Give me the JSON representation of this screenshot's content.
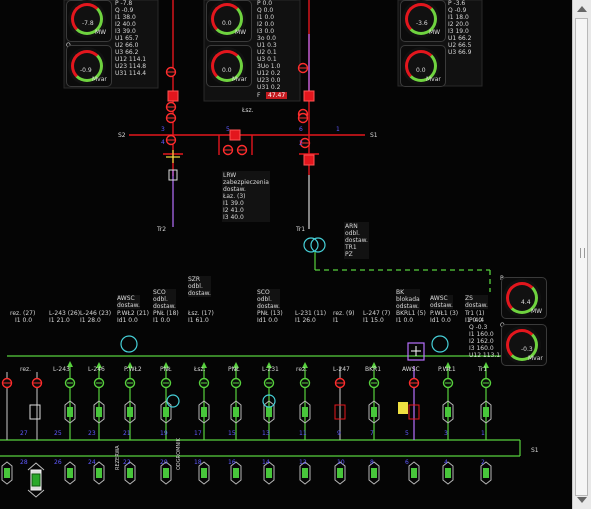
{
  "colors": {
    "bus": "#7ddc4d",
    "red": "#e3161d",
    "green": "#50d13c",
    "purple": "#b770ff",
    "cyan": "#46d0d8",
    "yellow": "#efe041",
    "bg": "#050505",
    "panel": "#111111",
    "text": "#d8d8d8"
  },
  "top_left_meters": [
    {
      "name": "P",
      "value": "-7.8",
      "unit": "MW"
    },
    {
      "name": "Q",
      "value": "-0.9",
      "unit": "Mvar"
    }
  ],
  "top_left_table": [
    "P    -7.8",
    "Q    -0.9",
    "I1   38.0",
    "I2   40.0",
    "I3   39.0",
    "U1   65.7",
    "U2   66.0",
    "U3   66.2",
    "U12  114.1",
    "U23  114.8",
    "U31  114.4"
  ],
  "top_mid_meters": [
    {
      "name": "P",
      "value": "0.0",
      "unit": "MW"
    },
    {
      "name": "Q",
      "value": "0.0",
      "unit": "Mvar"
    }
  ],
  "top_mid_table": [
    "P    0.0",
    "Q    0.0",
    "I1   0.0",
    "I2   0.0",
    "I3   0.0",
    "3o   0.0",
    "U1   0.3",
    "U2   0.1",
    "U3   0.1",
    "3Uo  1.0",
    "U12  0.2",
    "U23  0.0",
    "U31  0.2"
  ],
  "top_mid_alarm": {
    "label": "F",
    "value": "47.47"
  },
  "top_right_meters": [
    {
      "name": "P",
      "value": "-3.6",
      "unit": "MW"
    },
    {
      "name": "Q",
      "value": "0.0",
      "unit": "Mvar"
    }
  ],
  "top_right_table": [
    "P    -3.6",
    "Q    -0.9",
    "I1   18.0",
    "I2   20.0",
    "I3   19.0",
    "U1   66.2",
    "U2   66.5",
    "U3   66.9"
  ],
  "bus_labels": {
    "left": "S2",
    "right": "S1",
    "coupler": "Łsz.",
    "bottom": "S1",
    "lower_bus": "S1"
  },
  "field_numbers": [
    "3",
    "4",
    "5",
    "6",
    "1",
    "2"
  ],
  "tr2": {
    "label": "Tr2"
  },
  "tr1": {
    "label": "Tr1",
    "box": [
      "odbl.",
      "dostaw.",
      "TR1",
      "PZ"
    ]
  },
  "lrw_box": {
    "title": "LRW",
    "subtitle": "zabezpieczenia",
    "lines": [
      "dostaw.",
      "Łaz. (3)",
      "I1     39.0",
      "I2     41.0",
      "I3     40.0"
    ]
  },
  "arn_box": {
    "title": "ARN",
    "lines": [
      "odbl.",
      "dostaw.",
      "TR1",
      "PZ"
    ]
  },
  "right_meters": [
    {
      "name": "P",
      "value": "4.4",
      "unit": "MW"
    },
    {
      "name": "Q",
      "value": "-0.3",
      "unit": "Mvar"
    }
  ],
  "right_table": [
    "P    4.4",
    "Q   -0.3",
    "I1  160.0",
    "I2  162.0",
    "I3  160.0",
    "U12 113.1"
  ],
  "upper_boxes": [
    {
      "title": "SZR",
      "lines": [
        "odbl.",
        "dostaw."
      ]
    },
    {
      "title": "SCO",
      "lines": [
        "odbl.",
        "dostaw."
      ]
    },
    {
      "title": "AWSC",
      "lines": [
        "dostaw."
      ]
    },
    {
      "title": "SCO",
      "lines": [
        "odbl.",
        "dostaw."
      ]
    },
    {
      "title": "BK",
      "lines": [
        "blokada",
        "odstaw."
      ]
    },
    {
      "title": "AWSC",
      "lines": [
        "odstaw."
      ]
    },
    {
      "title": "ZS",
      "lines": [
        "dostaw."
      ]
    }
  ],
  "feeder_labels": [
    "rez. (27)",
    "L-243 (26)",
    "L-246 (23)",
    "P.WŁ2 (21)",
    "PNŁ (18)",
    "Łsz. (17)",
    "PNŁ (13)",
    "L-231 (11)",
    "rez. (9)",
    "L-247 (7)",
    "BKRL1 (5)",
    "P.WŁ1 (3)",
    "Tr1 (1)"
  ],
  "feeder_values": [
    "I1   0.0",
    "I1   21.0",
    "I1   28.0",
    "Id1  0.0",
    "I1   0.0",
    "I1   61.0",
    "Id1  0.0",
    "I1   26.0",
    "I1",
    "I1   15.0",
    "I1   0.0",
    "Id1  0.0",
    "I1   0.0"
  ],
  "feeder_names": [
    "rez.",
    "L-243",
    "L-246",
    "P.WŁ2",
    "PNŁ",
    "Łsz.",
    "PNŁ",
    "L-231",
    "rez.",
    "L-247",
    "BKR1",
    "AWSC",
    "P.WŁ1",
    "Tr1"
  ],
  "bay_numbers_top": [
    "27",
    "25",
    "23",
    "21",
    "19",
    "17",
    "15",
    "13",
    "11",
    "9",
    "7",
    "5",
    "3",
    "1"
  ],
  "bay_numbers_bottom": [
    "28",
    "26",
    "24",
    "22",
    "20",
    "18",
    "16",
    "14",
    "12",
    "10",
    "8",
    "6",
    "4",
    "2"
  ],
  "bottom_text": [
    "REZERWA",
    "ODGROMNIK"
  ],
  "scrollbar": {
    "up": "▲",
    "down": "▼"
  }
}
